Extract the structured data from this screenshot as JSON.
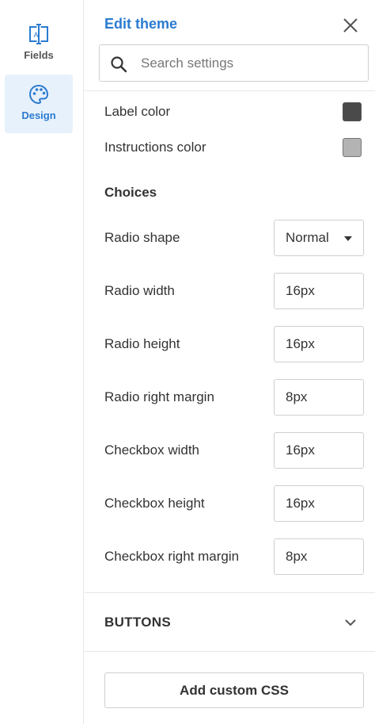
{
  "sidebar": {
    "items": [
      {
        "label": "Fields",
        "icon": "text-field-icon",
        "active": false
      },
      {
        "label": "Design",
        "icon": "palette-icon",
        "active": true
      }
    ]
  },
  "panel": {
    "title": "Edit theme",
    "search": {
      "placeholder": "Search settings",
      "value": ""
    },
    "colors": [
      {
        "label": "Label color",
        "swatch": "#4a4a4a"
      },
      {
        "label": "Instructions color",
        "swatch": "#b3b3b3"
      }
    ],
    "choices": {
      "title": "Choices",
      "radio_shape": {
        "label": "Radio shape",
        "value": "Normal"
      },
      "radio_width": {
        "label": "Radio width",
        "value": "16px"
      },
      "radio_height": {
        "label": "Radio height",
        "value": "16px"
      },
      "radio_right_margin": {
        "label": "Radio right margin",
        "value": "8px"
      },
      "checkbox_width": {
        "label": "Checkbox width",
        "value": "16px"
      },
      "checkbox_height": {
        "label": "Checkbox height",
        "value": "16px"
      },
      "checkbox_right_margin": {
        "label": "Checkbox right margin",
        "value": "8px"
      }
    },
    "buttons_section": {
      "title": "BUTTONS"
    },
    "custom_css_label": "Add custom CSS"
  },
  "colors": {
    "accent": "#2b7bd0",
    "active_bg": "#e7f1fb"
  }
}
